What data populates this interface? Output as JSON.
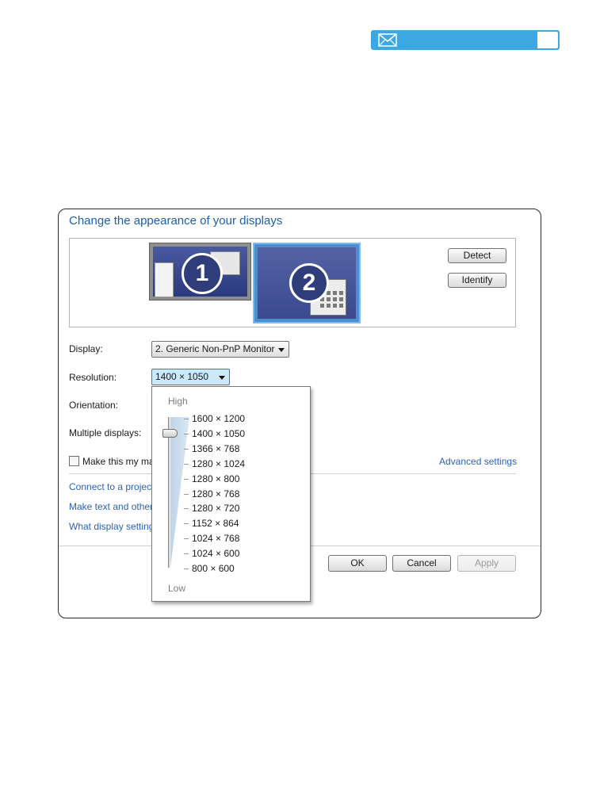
{
  "window": {
    "title": "Change the appearance of your displays"
  },
  "monitors": {
    "m1_number": "1",
    "m2_number": "2",
    "detect_label": "Detect",
    "identify_label": "Identify"
  },
  "fields": {
    "display_label": "Display:",
    "display_value": "2. Generic Non-PnP Monitor",
    "resolution_label": "Resolution:",
    "resolution_value": "1400 × 1050",
    "orientation_label": "Orientation:",
    "multiple_label": "Multiple displays:",
    "main_display_checkbox": "Make this my ma",
    "advanced_link": "Advanced settings"
  },
  "links": [
    "Connect to a projec",
    "Make text and other",
    "What display setting"
  ],
  "resolution_dropdown": {
    "high_label": "High",
    "low_label": "Low",
    "options": [
      "1600 × 1200",
      "1400 × 1050",
      "1366 × 768",
      "1280 × 1024",
      "1280 × 800",
      "1280 × 768",
      "1280 × 720",
      "1152 × 864",
      "1024 × 768",
      "1024 × 600",
      "800 × 600"
    ],
    "selected_index": 1
  },
  "buttons": {
    "ok": "OK",
    "cancel": "Cancel",
    "apply": "Apply"
  },
  "colors": {
    "mail_bar": "#3da7e3",
    "title_blue": "#1f5ea8",
    "link_blue": "#2b63b6"
  },
  "icons": {
    "mail": "envelope-icon"
  }
}
